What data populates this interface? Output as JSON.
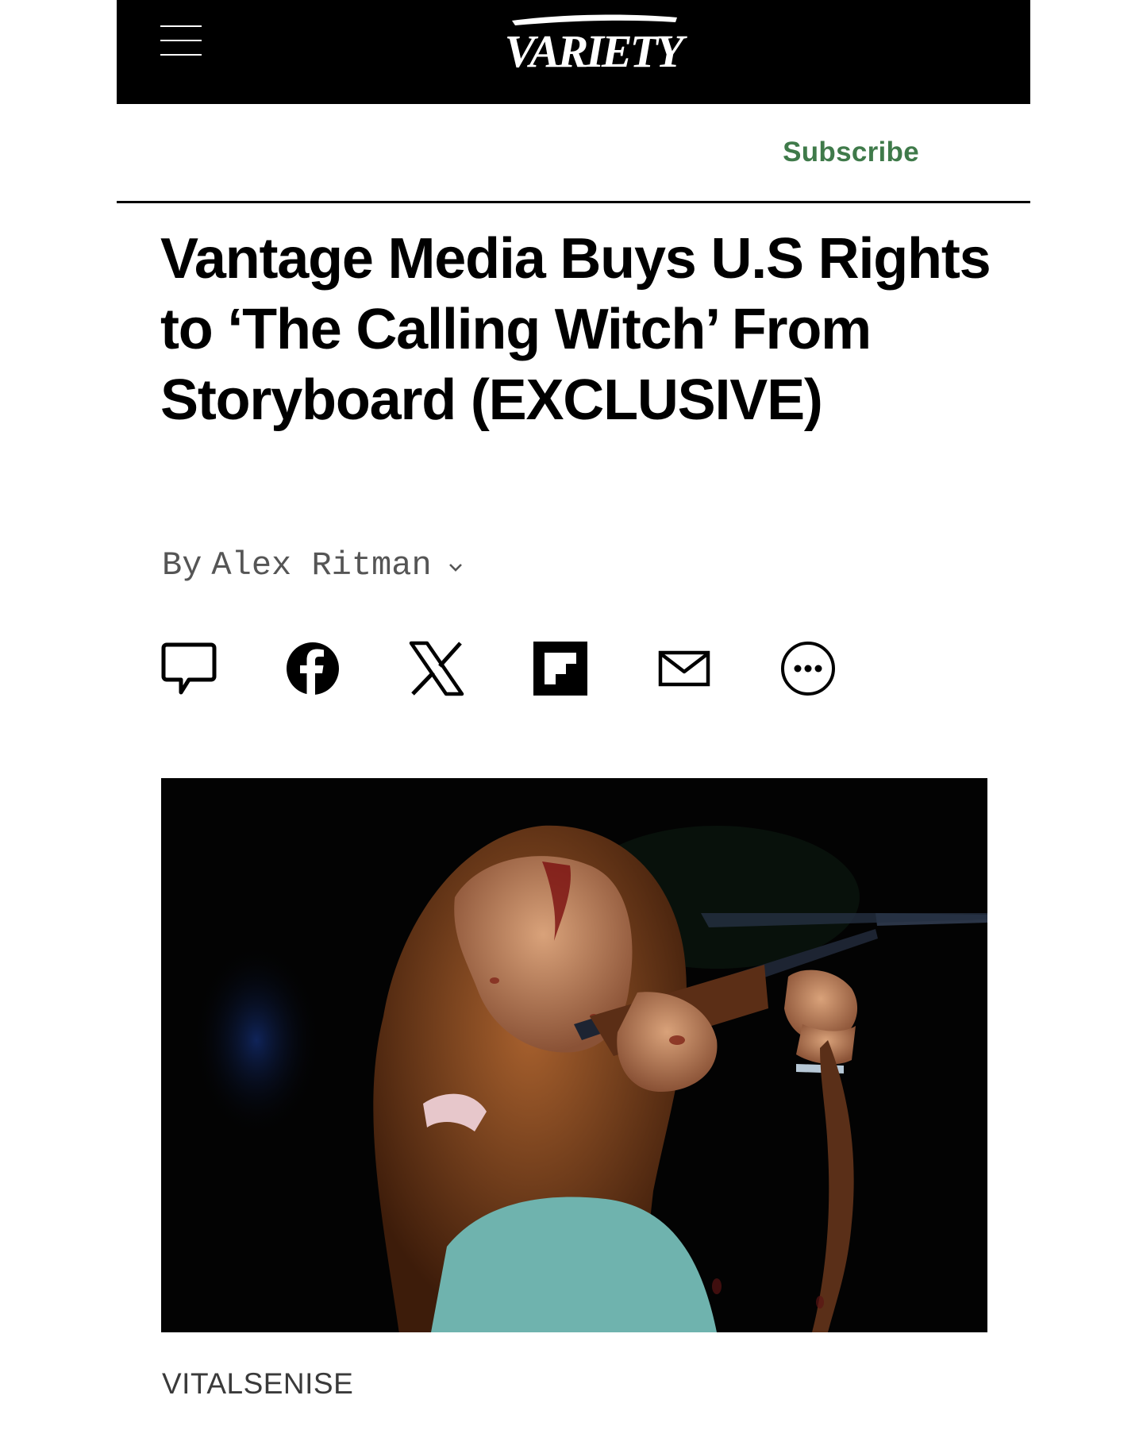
{
  "header": {
    "brand": "VARIETY",
    "menu_icon": "hamburger-menu-icon",
    "background": "#000000"
  },
  "subscribe_label": "Subscribe",
  "accent_color": "#3f7a4a",
  "article": {
    "headline": "Vantage Media Buys U.S Rights to ‘The Calling Witch’ From Storyboard (EXCLUSIVE)",
    "byline_prefix": "By",
    "author": "Alex Ritman",
    "share_icons": [
      "comment-icon",
      "facebook-icon",
      "x-icon",
      "flipboard-icon",
      "email-icon",
      "more-icon"
    ],
    "image_credit": "VITALSENISE"
  }
}
